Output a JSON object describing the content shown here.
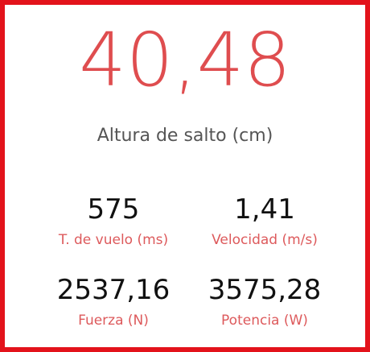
{
  "main": {
    "value": "40,48",
    "label": "Altura de salto (cm)"
  },
  "stats": [
    {
      "value": "575",
      "label": "T. de vuelo (ms)"
    },
    {
      "value": "1,41",
      "label": "Velocidad (m/s)"
    },
    {
      "value": "2537,16",
      "label": "Fuerza (N)"
    },
    {
      "value": "3575,28",
      "label": "Potencia (W)"
    }
  ],
  "colors": {
    "frame": "#e3131b",
    "accent": "#df4d4f",
    "value_text": "#111111",
    "label_text": "#555555"
  }
}
